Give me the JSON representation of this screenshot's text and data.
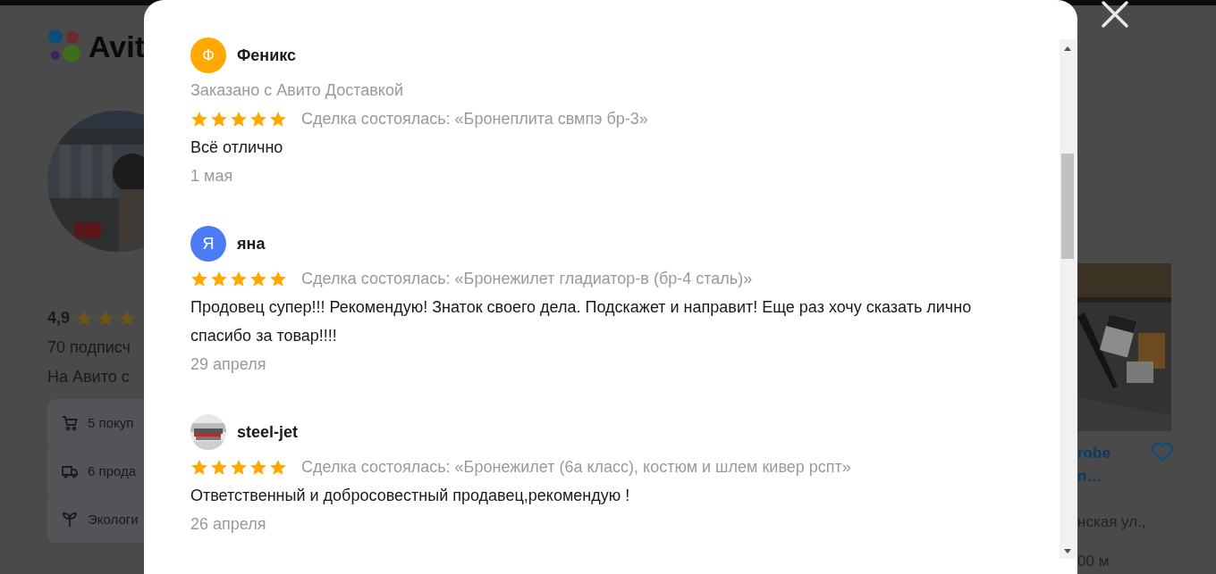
{
  "background_page": {
    "logo": "Avit",
    "seller": {
      "rating": "4,9",
      "stars": 3,
      "subscribers": "70 подписч",
      "since": "На Авито с",
      "stats": [
        {
          "kind": "cart",
          "label": "5 покуп"
        },
        {
          "kind": "truck",
          "label": "6 прода"
        },
        {
          "kind": "plant",
          "label": "Экологи"
        }
      ]
    },
    "listing": {
      "title_lines": [
        "robe",
        "п…"
      ],
      "address": "нская ул.,",
      "distance": "00 м"
    }
  },
  "reviews_modal": {
    "reviews": [
      {
        "author": "Феникс",
        "avatar": {
          "kind": "letter",
          "letter": "Ф",
          "color": "#ffa800"
        },
        "note": "Заказано с Авито Доставкой",
        "stars": 5,
        "deal": "Сделка состоялась: «Бронеплита свмпэ бр-3»",
        "text": "Всё отлично",
        "date": "1 мая"
      },
      {
        "author": "яна",
        "avatar": {
          "kind": "letter",
          "letter": "Я",
          "color": "#4b7cf5"
        },
        "stars": 5,
        "deal": "Сделка состоялась: «Бронежилет гладиатор-в (бр-4 сталь)»",
        "text": "Продовец супер!!! Рекомендую! Знаток своего дела. Подскажет и направит! Еще раз хочу сказать лично спасибо за товар!!!!",
        "date": "29 апреля"
      },
      {
        "author": "steel-jet",
        "stars": 5,
        "deal": "Сделка состоялась: «Бронежилет (6а класс), костюм и шлем кивер рспт»",
        "text": "Ответственный и добросовестный продавец,рекомендую !",
        "date": "26 апреля"
      }
    ]
  }
}
